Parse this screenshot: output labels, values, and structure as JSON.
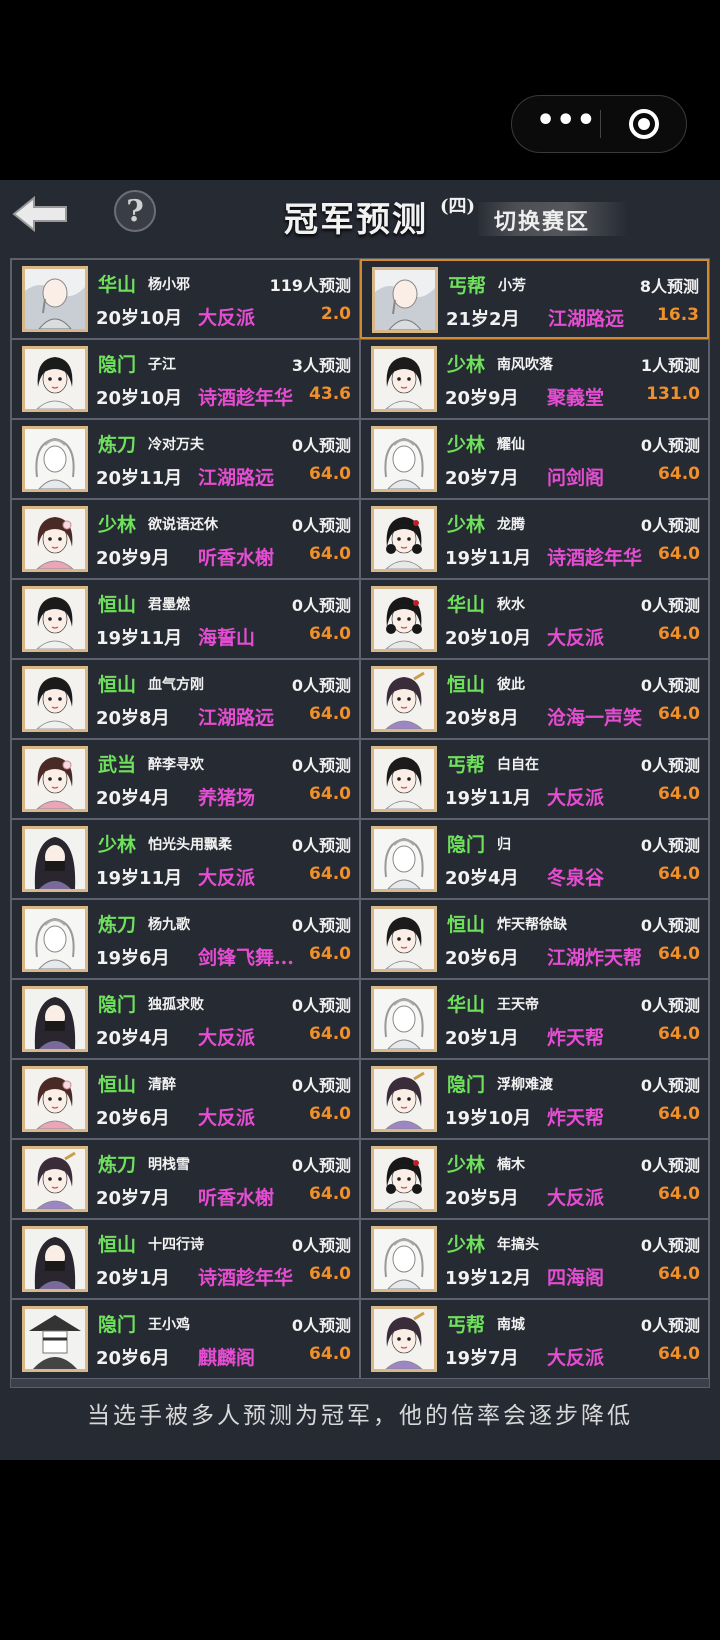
{
  "capsule": {
    "menu_glyph": "•••"
  },
  "header": {
    "title": "冠军预测",
    "title_sup": "(四)",
    "switch_label": "切换赛区"
  },
  "left": [
    {
      "sect": "华山",
      "name": "杨小邪",
      "predict": "119人预测",
      "age": "20岁10月",
      "team": "大反派",
      "odds": "2.0",
      "avatar": "monk"
    },
    {
      "sect": "隐门",
      "name": "子江",
      "predict": "3人预测",
      "age": "20岁10月",
      "team": "诗酒趁年华",
      "odds": "43.6",
      "avatar": "boy"
    },
    {
      "sect": "炼刀",
      "name": "冷对万夫",
      "predict": "0人预测",
      "age": "20岁11月",
      "team": "江湖路远",
      "odds": "64.0",
      "avatar": "sketch"
    },
    {
      "sect": "少林",
      "name": "欲说语还休",
      "predict": "0人预测",
      "age": "20岁9月",
      "team": "听香水榭",
      "odds": "64.0",
      "avatar": "girl"
    },
    {
      "sect": "恒山",
      "name": "君墨燃",
      "predict": "0人预测",
      "age": "19岁11月",
      "team": "海誓山",
      "odds": "64.0",
      "avatar": "boy"
    },
    {
      "sect": "恒山",
      "name": "血气方刚",
      "predict": "0人预测",
      "age": "20岁8月",
      "team": "江湖路远",
      "odds": "64.0",
      "avatar": "boy"
    },
    {
      "sect": "武当",
      "name": "醉李寻欢",
      "predict": "0人预测",
      "age": "20岁4月",
      "team": "养猪场",
      "odds": "64.0",
      "avatar": "girl"
    },
    {
      "sect": "少林",
      "name": "怕光头用飘柔",
      "predict": "0人预测",
      "age": "19岁11月",
      "team": "大反派",
      "odds": "64.0",
      "avatar": "masked"
    },
    {
      "sect": "炼刀",
      "name": "杨九歌",
      "predict": "0人预测",
      "age": "19岁6月",
      "team": "剑锋飞舞...",
      "odds": "64.0",
      "avatar": "sketch"
    },
    {
      "sect": "隐门",
      "name": "独孤求败",
      "predict": "0人预测",
      "age": "20岁4月",
      "team": "大反派",
      "odds": "64.0",
      "avatar": "masked"
    },
    {
      "sect": "恒山",
      "name": "清醉",
      "predict": "0人预测",
      "age": "20岁6月",
      "team": "大反派",
      "odds": "64.0",
      "avatar": "girl"
    },
    {
      "sect": "炼刀",
      "name": "明栈雪",
      "predict": "0人预测",
      "age": "20岁7月",
      "team": "听香水榭",
      "odds": "64.0",
      "avatar": "lady"
    },
    {
      "sect": "恒山",
      "name": "十四行诗",
      "predict": "0人预测",
      "age": "20岁1月",
      "team": "诗酒趁年华",
      "odds": "64.0",
      "avatar": "masked"
    },
    {
      "sect": "隐门",
      "name": "王小鸡",
      "predict": "0人预测",
      "age": "20岁6月",
      "team": "麒麟阁",
      "odds": "64.0",
      "avatar": "hat"
    }
  ],
  "right": [
    {
      "sect": "丐帮",
      "name": "小芳",
      "predict": "8人预测",
      "age": "21岁2月",
      "team": "江湖路远",
      "odds": "16.3",
      "avatar": "monk",
      "selected": true
    },
    {
      "sect": "少林",
      "name": "南风吹落",
      "predict": "1人预测",
      "age": "20岁9月",
      "team": "聚義堂",
      "odds": "131.0",
      "avatar": "boy"
    },
    {
      "sect": "少林",
      "name": "耀仙",
      "predict": "0人预测",
      "age": "20岁7月",
      "team": "问剑阁",
      "odds": "64.0",
      "avatar": "sketch"
    },
    {
      "sect": "少林",
      "name": "龙腾",
      "predict": "0人预测",
      "age": "19岁11月",
      "team": "诗酒趁年华",
      "odds": "64.0",
      "avatar": "girl2"
    },
    {
      "sect": "华山",
      "name": "秋水",
      "predict": "0人预测",
      "age": "20岁10月",
      "team": "大反派",
      "odds": "64.0",
      "avatar": "girl2"
    },
    {
      "sect": "恒山",
      "name": "彼此",
      "predict": "0人预测",
      "age": "20岁8月",
      "team": "沧海一声笑",
      "odds": "64.0",
      "avatar": "lady"
    },
    {
      "sect": "丐帮",
      "name": "白自在",
      "predict": "0人预测",
      "age": "19岁11月",
      "team": "大反派",
      "odds": "64.0",
      "avatar": "boy"
    },
    {
      "sect": "隐门",
      "name": "归",
      "predict": "0人预测",
      "age": "20岁4月",
      "team": "冬泉谷",
      "odds": "64.0",
      "avatar": "sketch"
    },
    {
      "sect": "恒山",
      "name": "炸天帮徐缺",
      "predict": "0人预测",
      "age": "20岁6月",
      "team": "江湖炸天帮",
      "odds": "64.0",
      "avatar": "boy"
    },
    {
      "sect": "华山",
      "name": "王天帝",
      "predict": "0人预测",
      "age": "20岁1月",
      "team": "炸天帮",
      "odds": "64.0",
      "avatar": "sketch"
    },
    {
      "sect": "隐门",
      "name": "浮柳难渡",
      "predict": "0人预测",
      "age": "19岁10月",
      "team": "炸天帮",
      "odds": "64.0",
      "avatar": "lady"
    },
    {
      "sect": "少林",
      "name": "楠木",
      "predict": "0人预测",
      "age": "20岁5月",
      "team": "大反派",
      "odds": "64.0",
      "avatar": "girl2"
    },
    {
      "sect": "少林",
      "name": "年搞头",
      "predict": "0人预测",
      "age": "19岁12月",
      "team": "四海阁",
      "odds": "64.0",
      "avatar": "sketch"
    },
    {
      "sect": "丐帮",
      "name": "南城",
      "predict": "0人预测",
      "age": "19岁7月",
      "team": "大反派",
      "odds": "64.0",
      "avatar": "lady"
    }
  ],
  "footer": "当选手被多人预测为冠军，他的倍率会逐步降低"
}
